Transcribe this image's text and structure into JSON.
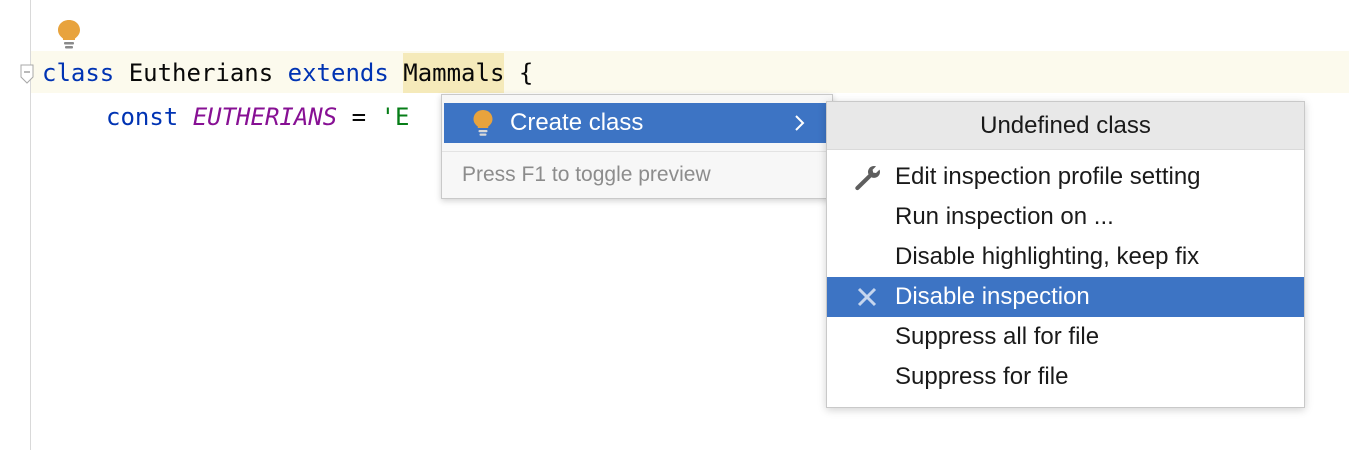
{
  "editor": {
    "line1": {
      "kw_class": "class",
      "name": " Eutherians ",
      "kw_extends": "extends",
      "space": " ",
      "parent": "Mammals",
      "brace": " {"
    },
    "line2": {
      "kw_const": "const",
      "space": " ",
      "const_name": "EUTHERIANS",
      "equals": " = ",
      "string_start": "'E"
    }
  },
  "intention_popup": {
    "item_label": "Create class",
    "hint": "Press F1 to toggle preview"
  },
  "submenu": {
    "header": "Undefined class",
    "items": [
      {
        "label": "Edit inspection profile setting",
        "icon": "wrench-icon"
      },
      {
        "label": "Run inspection on ...",
        "icon": ""
      },
      {
        "label": "Disable highlighting, keep fix",
        "icon": ""
      },
      {
        "label": "Disable inspection",
        "icon": "close-icon",
        "selected": true
      },
      {
        "label": "Suppress all for file",
        "icon": ""
      },
      {
        "label": "Suppress for file",
        "icon": ""
      }
    ]
  },
  "colors": {
    "selection": "#3d74c4",
    "bulb": "#e8a33d",
    "keyword": "#0033b3",
    "constant": "#871094",
    "string": "#067d17"
  }
}
